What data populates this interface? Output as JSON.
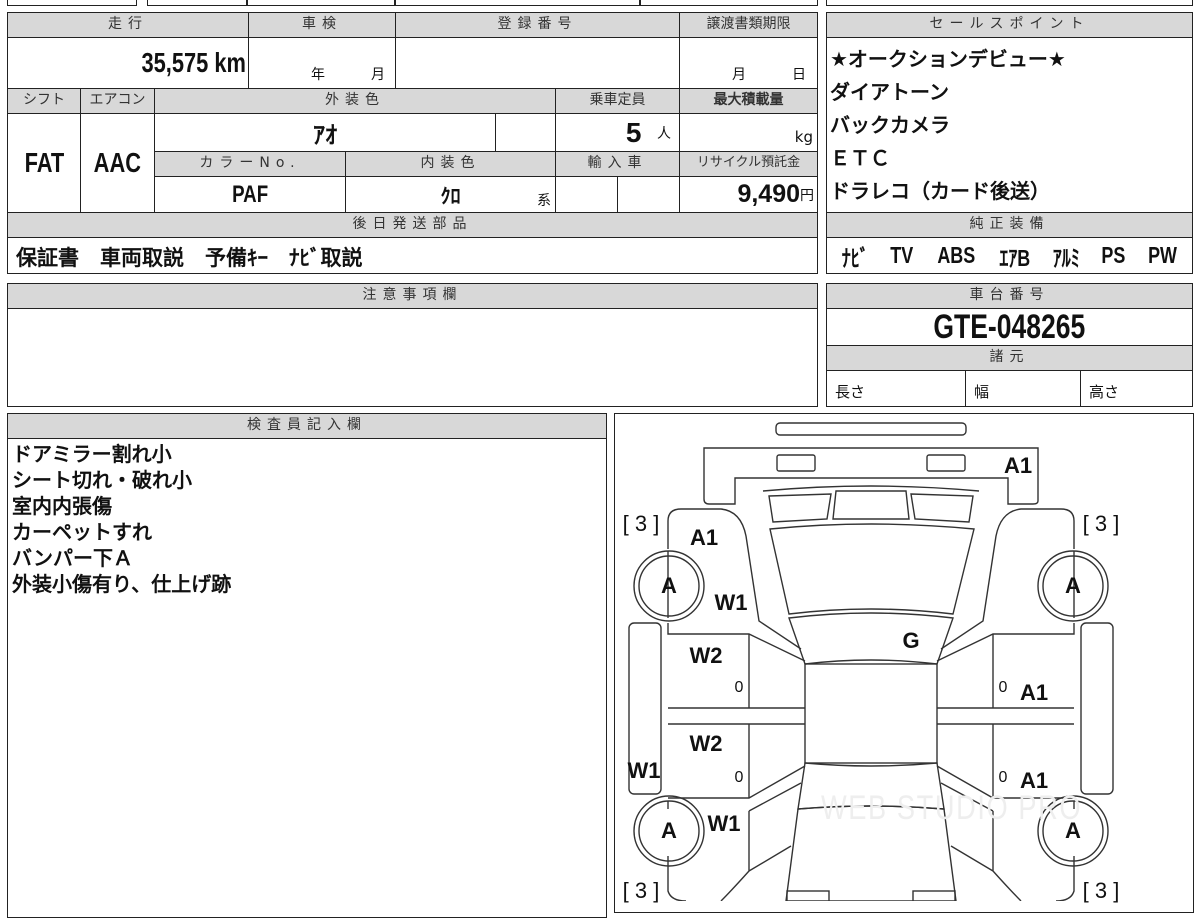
{
  "basic": {
    "mileage_header": "走行",
    "mileage": "35,575",
    "mileage_unit": "km",
    "shaken_header": "車検",
    "shaken_year": "年",
    "shaken_month": "月",
    "reg_header": "登録番号",
    "transfer_header": "譲渡書類期限",
    "transfer_month": "月",
    "transfer_day": "日",
    "shift_header": "シフト",
    "shift": "FAT",
    "ac_header": "エアコン",
    "ac": "AAC",
    "exterior_header": "外装色",
    "exterior": "ｱｵ",
    "capacity_header": "乗車定員",
    "capacity": "5",
    "capacity_unit": "人",
    "load_header": "最大積載量",
    "load_unit": "kg",
    "colorno_header": "カラーNo.",
    "colorno": "PAF",
    "interior_header": "内装色",
    "interior": "ｸﾛ",
    "interior_suffix": "系",
    "import_header": "輸入車",
    "recycle_header": "リサイクル預託金",
    "recycle": "9,490",
    "recycle_unit": "円",
    "parts_header": "後日発送部品",
    "parts": "保証書　車両取説　予備ｷｰ　ﾅﾋﾞ取説"
  },
  "sales": {
    "header": "セールスポイント",
    "items": [
      "★オークションデビュー★",
      "ダイアトーン",
      "バックカメラ",
      "ＥＴＣ",
      "ドラレコ（カード後送）"
    ]
  },
  "equipment": {
    "header": "純正装備",
    "items": [
      "ﾅﾋﾞ",
      "TV",
      "ABS",
      "ｴｱB",
      "ｱﾙﾐ",
      "PS",
      "PW"
    ]
  },
  "notes": {
    "header": "注意事項欄"
  },
  "chassis": {
    "header": "車台番号",
    "number": "GTE-048265",
    "spec_header": "諸元",
    "length": "長さ",
    "width": "幅",
    "height": "高さ"
  },
  "inspector": {
    "header": "検査員記入欄",
    "items": [
      "ドアミラー割れ小",
      "シート切れ・破れ小",
      "室内内張傷",
      "カーペットすれ",
      "バンパー下Ａ",
      "外装小傷有り、仕上げ跡"
    ]
  },
  "diagram": {
    "labels": [
      "A1",
      "[ 3 ]",
      "[ 3 ]",
      "A1",
      "W1",
      "G",
      "W2",
      "0",
      "0",
      "A1",
      "W2",
      "W1",
      "0",
      "0",
      "A1",
      "W1",
      "[ 3 ]",
      "[ 3 ]",
      "A",
      "A",
      "A",
      "A"
    ],
    "watermark": "WEB STUDIO PRO"
  }
}
